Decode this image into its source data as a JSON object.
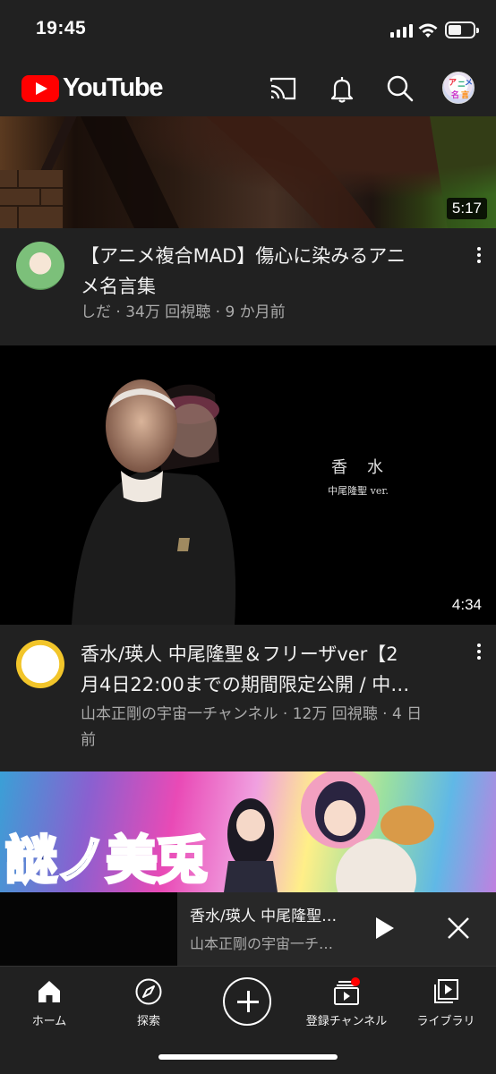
{
  "status_bar": {
    "time": "19:45"
  },
  "header": {
    "brand": "YouTube",
    "icons": [
      "cast-icon",
      "bell-icon",
      "search-icon",
      "avatar"
    ]
  },
  "videos": [
    {
      "duration": "5:17",
      "title_line1": "【アニメ複合MAD】傷心に染みるアニ",
      "title_line2": "メ名言集",
      "subtitle": "しだ · 34万 回視聴 · 9 か月前"
    },
    {
      "duration": "4:34",
      "thumb_title": "香　水",
      "thumb_subtitle": "中尾隆聖 ver.",
      "title_line1": "香水/瑛人 中尾隆聖＆フリーザver【2",
      "title_line2": "月4日22:00までの期間限定公開 / 中…",
      "subtitle_line1": "山本正剛の宇宙一チャンネル · 12万 回視聴 · 4 日",
      "subtitle_line2": "前"
    },
    {
      "thumb_text": "謎ノ美兎"
    }
  ],
  "mini_player": {
    "title": "香水/瑛人 中尾隆聖…",
    "channel": "山本正剛の宇宙一チ…"
  },
  "bottom_nav": {
    "home": "ホーム",
    "explore": "探索",
    "subscriptions": "登録チャンネル",
    "library": "ライブラリ"
  },
  "colors": {
    "background": "#181818",
    "header": "#212121",
    "brand_red": "#ff0000",
    "secondary_text": "#aaaaaa"
  }
}
